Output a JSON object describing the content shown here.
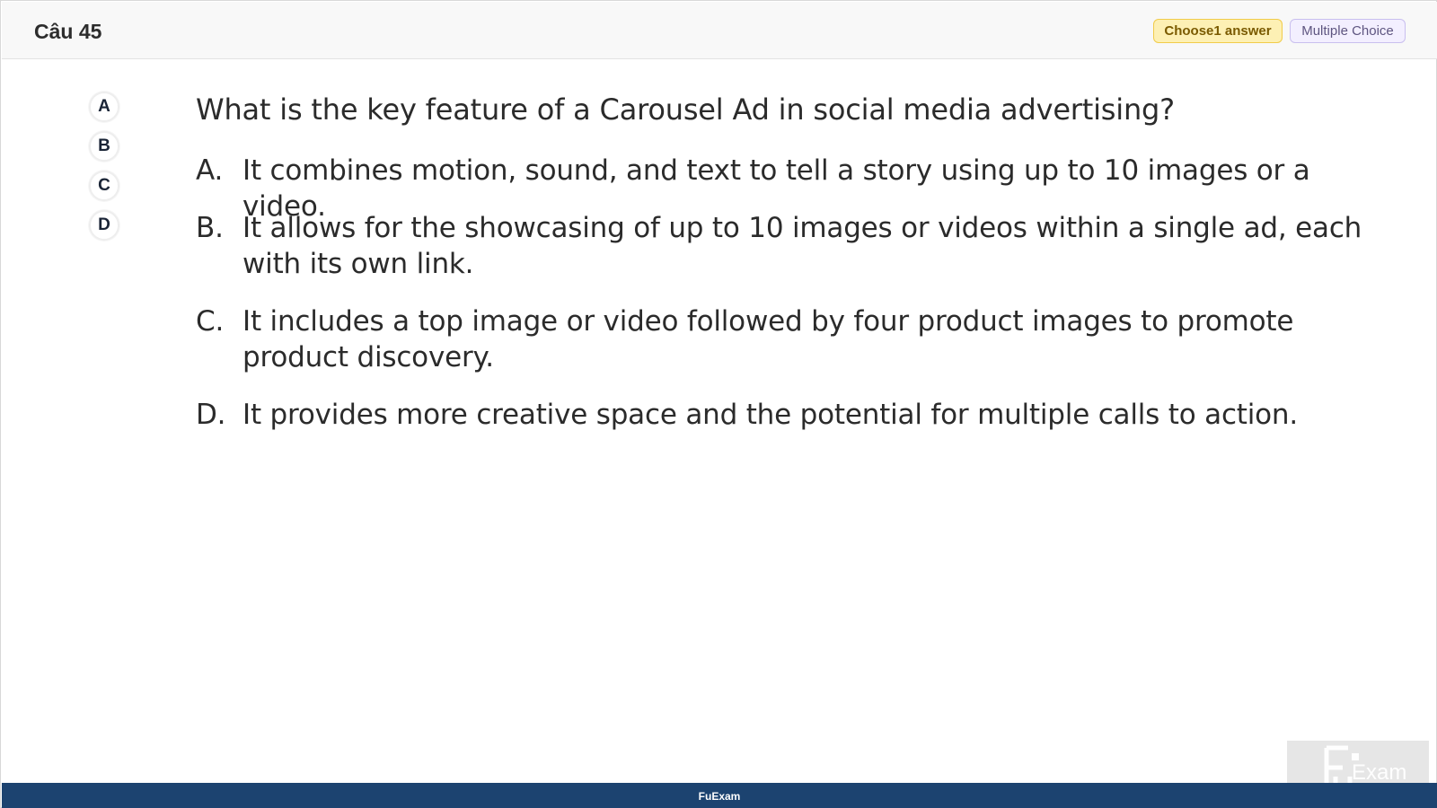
{
  "header": {
    "title": "Câu 45",
    "choose_badge": "Choose1 answer",
    "type_badge": "Multiple Choice"
  },
  "option_buttons": [
    "A",
    "B",
    "C",
    "D"
  ],
  "question": "What is the key feature of a Carousel Ad in social media advertising?",
  "answers": [
    {
      "letter": "A.",
      "text": "It combines motion, sound, and text to tell a story using up to 10 images or a video."
    },
    {
      "letter": "B.",
      "text": "It allows for the showcasing of up to 10 images or videos within a single ad, each with its own link."
    },
    {
      "letter": "C.",
      "text": "It includes a top image or video followed by four product images to promote product discovery."
    },
    {
      "letter": "D.",
      "text": "It provides more creative space and the potential for multiple calls to action."
    }
  ],
  "footer": {
    "brand": "FuExam"
  },
  "watermark": {
    "text": "Exam"
  },
  "colors": {
    "footer_bg": "#1c4370",
    "choose_badge_bg": "#fdf0b4",
    "type_badge_bg": "#f3efff"
  }
}
